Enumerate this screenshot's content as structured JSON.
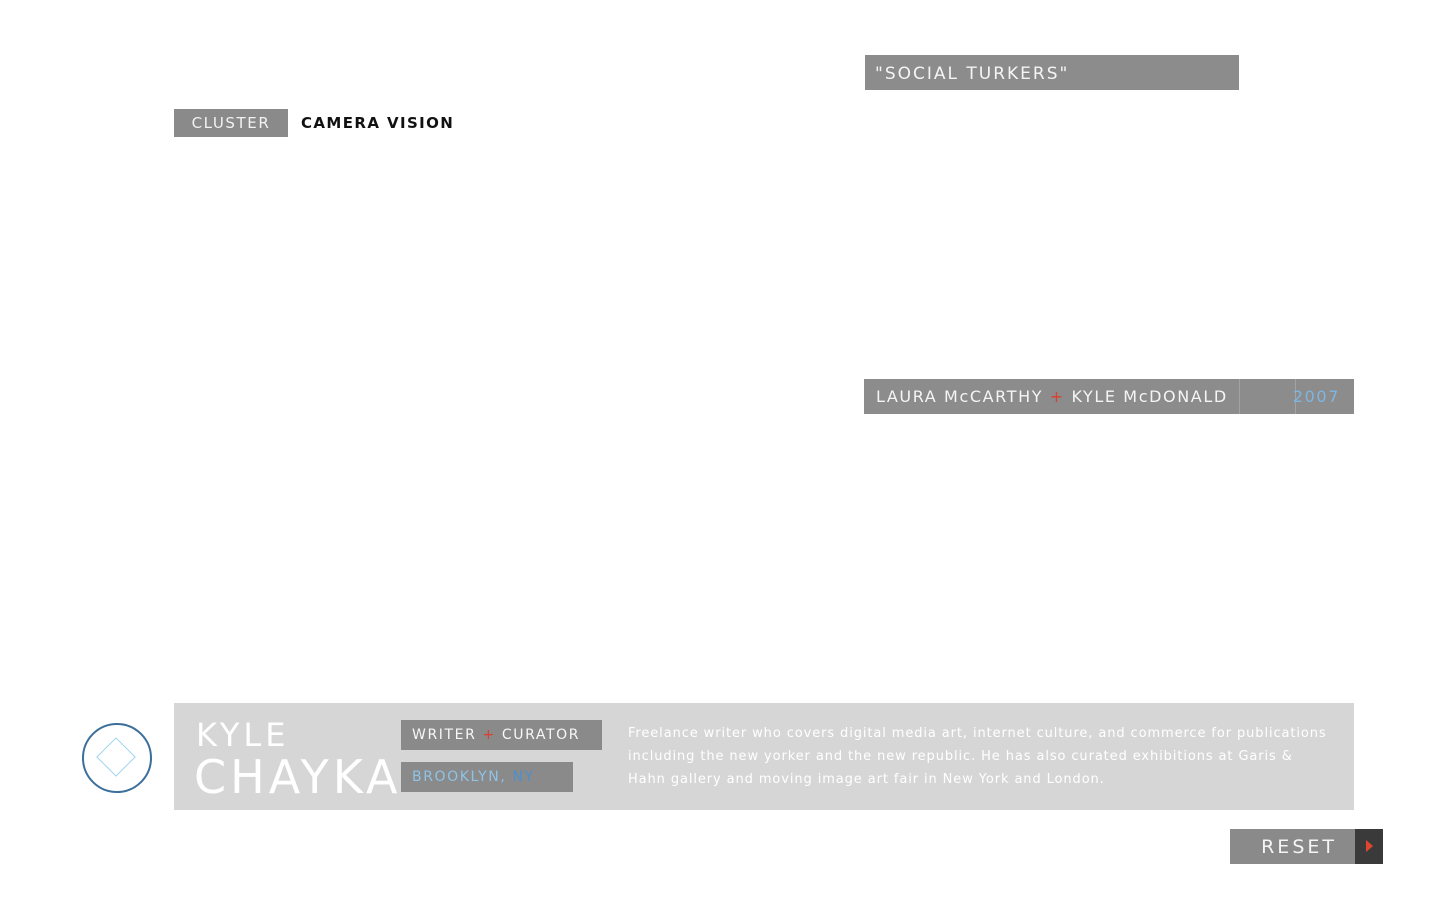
{
  "cluster": {
    "tag_label": "CLUSTER",
    "name": "CAMERA VISION"
  },
  "work": {
    "title": "\"SOCIAL TURKERS\"",
    "artist_1": "LAURA McCARTHY",
    "separator": "+",
    "artist_2": "KYLE McDONALD",
    "year": "2007"
  },
  "profile": {
    "first_name": "KYLE",
    "last_name": "CHAYKA",
    "role_1": "WRITER",
    "role_separator": "+",
    "role_2": "CURATOR",
    "city": "BROOKLYN,",
    "state": "NY",
    "bio": "Freelance writer who covers digital media art, internet culture, and commerce for publications including the new yorker and the new republic. He has also curated exhibitions at Garis & Hahn gallery and moving image art fair in New York and London."
  },
  "controls": {
    "reset_label": "RESET"
  },
  "colors": {
    "bar_gray": "#8a8a8a",
    "card_gray": "#d6d6d6",
    "accent_red": "#d9402f",
    "accent_blue": "#7fb6df",
    "avatar_ring": "#3c6f9b"
  },
  "icons": {
    "avatar": "diamond-icon",
    "reset": "play-arrow-icon"
  }
}
